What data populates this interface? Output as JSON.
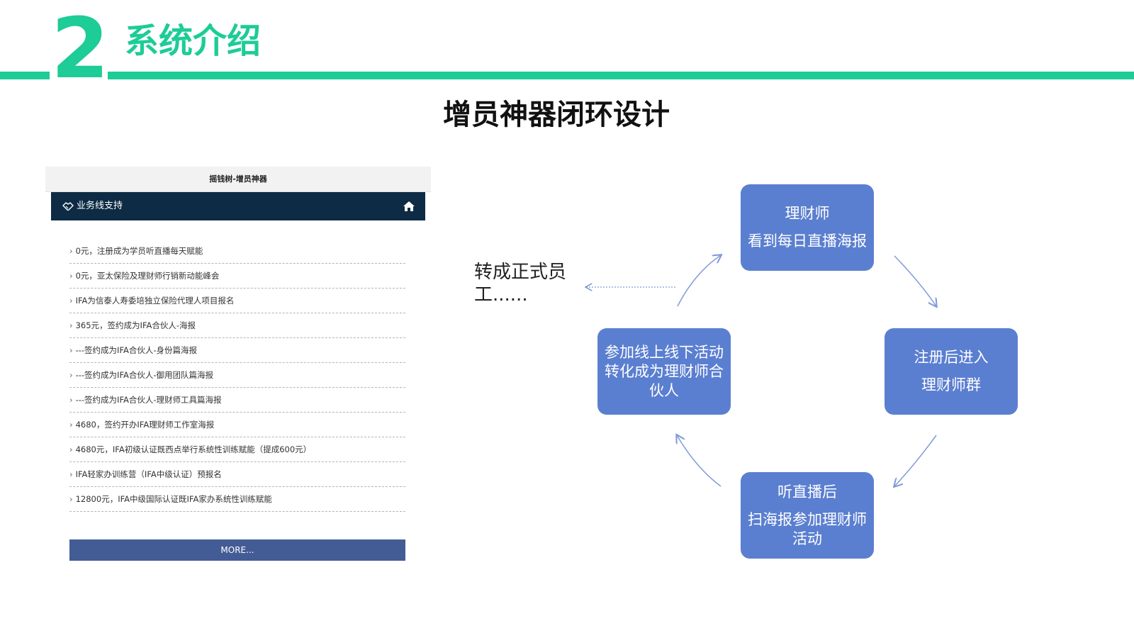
{
  "header": {
    "section_number": "2",
    "section_title": "系统介绍"
  },
  "main_title": "增员神器闭环设计",
  "phone": {
    "page_title": "摇钱树-增员神器",
    "nav_label": "业务线支持",
    "items": [
      "0元，注册成为学员听直播每天赋能",
      "0元，亚太保险及理财师行销新动能峰会",
      "IFA为信泰人寿委培独立保险代理人项目报名",
      "365元，签约成为IFA合伙人-海报",
      "---签约成为IFA合伙人-身份篇海报",
      "---签约成为IFA合伙人-御用团队篇海报",
      "---签约成为IFA合伙人-理财师工具篇海报",
      "4680，签约开办IFA理财师工作室海报",
      "4680元，IFA初级认证既西点举行系统性训练赋能（提成600元）",
      "IFA轻家办训练营（IFA中级认证）预报名",
      "12800元，IFA中级国际认证既IFA家办系统性训练赋能"
    ],
    "more_label": "MORE..."
  },
  "diagram": {
    "top": {
      "line1": "理财师",
      "line2": "看到每日直播海报"
    },
    "right": {
      "line1": "注册后进入",
      "line2": "理财师群"
    },
    "bottom": {
      "line1": "听直播后",
      "line2": "扫海报参加理财师活动"
    },
    "left": {
      "text": "参加线上线下活动转化成为理财师合伙人"
    },
    "side_text": "转成正式员工......"
  },
  "colors": {
    "accent_green": "#1dcc96",
    "node_blue": "#5b7fd0",
    "nav_dark": "#0d2b44",
    "button_blue": "#445c95"
  }
}
